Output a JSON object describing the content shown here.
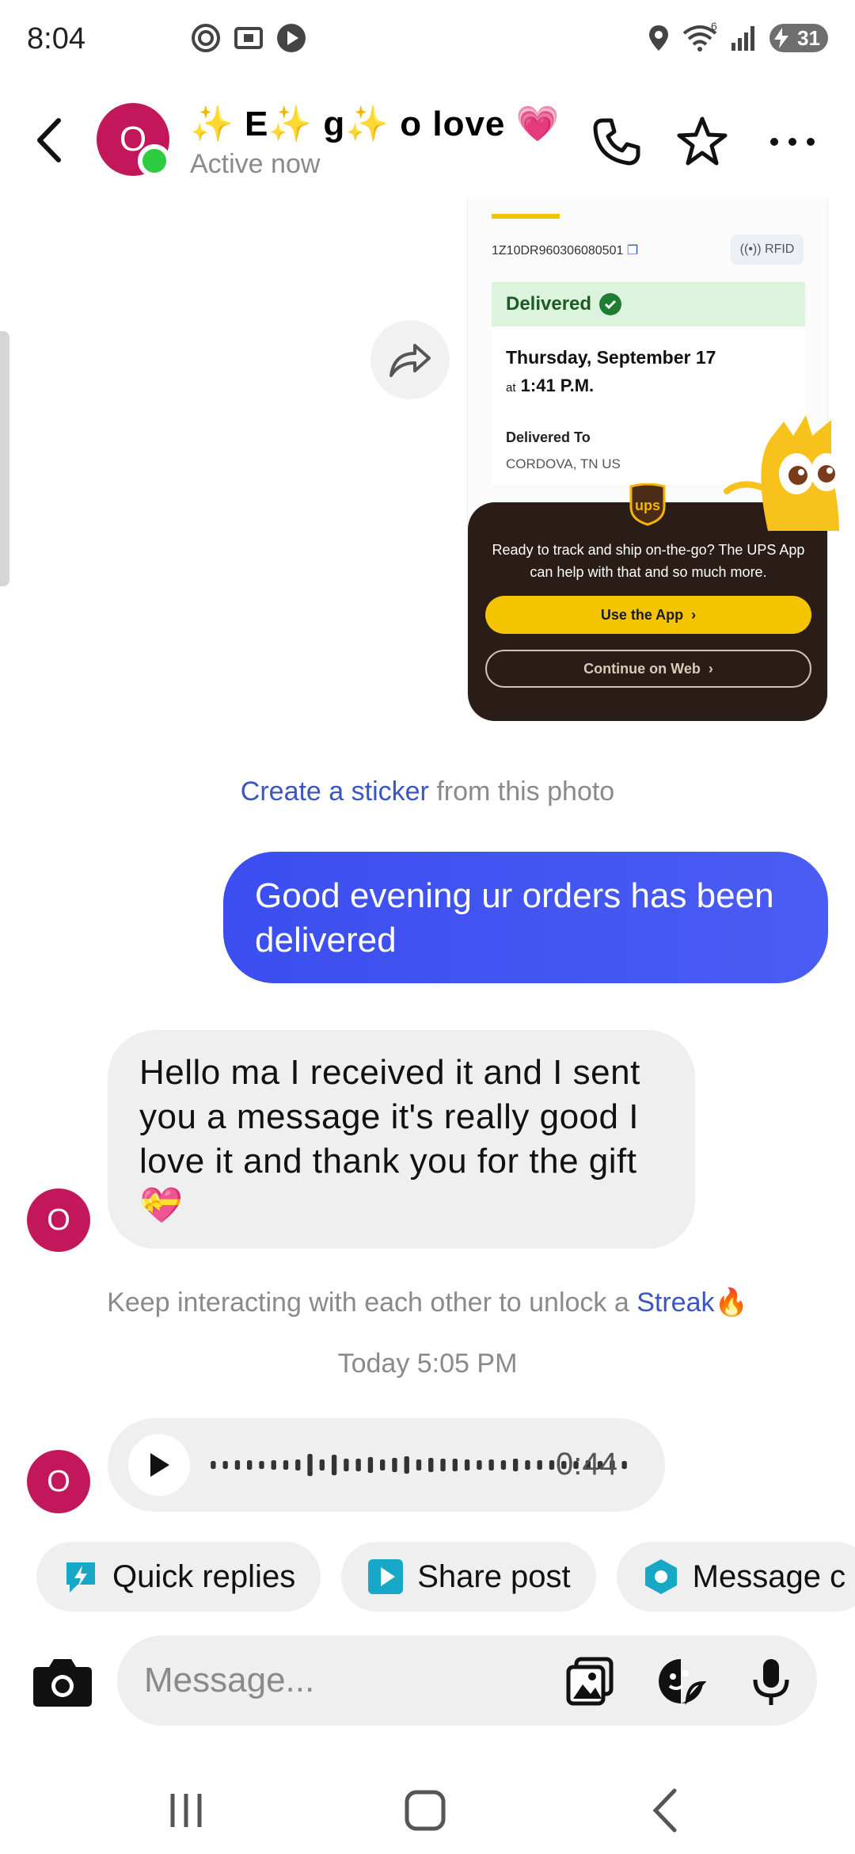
{
  "status_bar": {
    "time": "8:04",
    "battery": "31",
    "signal_label": "6",
    "left_icons": [
      "focus-icon",
      "screen-record-icon",
      "play-icon"
    ],
    "right_icons": [
      "location-icon",
      "wifi-icon",
      "signal-icon",
      "battery-icon"
    ]
  },
  "header": {
    "contact_name": "✨ E✨ g✨ o  love 💗",
    "avatar_initial": "O",
    "status": "Active now",
    "icons": [
      "back-icon",
      "phone-icon",
      "star-icon",
      "more-icon"
    ]
  },
  "shared_image": {
    "tracking_number": "1Z10DR960306080501",
    "rfid_label": "((•)) RFID",
    "delivered_label": "Delivered",
    "date": "Thursday, September 17",
    "time_prefix": "at",
    "time": "1:41 P.M.",
    "delivered_to_label": "Delivered To",
    "city": "CORDOVA, TN US",
    "promo_text": "Ready to track and ship on-the-go? The UPS App can help with that and so much more.",
    "use_app_label": "Use the App",
    "continue_web_label": "Continue on Web",
    "logo_text": "ups"
  },
  "sticker_prompt": {
    "link": "Create a sticker",
    "rest": " from this photo"
  },
  "messages": {
    "outgoing_1": "Good evening ur orders has been delivered",
    "incoming_1": "Hello ma I  received it and I sent you a message it's really good  I love it and thank you for the gift 💝",
    "incoming_avatar": "O"
  },
  "streak": {
    "text": "Keep interacting with each other to unlock a ",
    "link": "Streak",
    "emoji": "🔥"
  },
  "timestamp": "Today 5:05 PM",
  "voice_message": {
    "duration": "0:44"
  },
  "chips": [
    {
      "label": "Quick replies",
      "icon": "lightning-icon",
      "color": "#17a7c7"
    },
    {
      "label": "Share post",
      "icon": "play-square-icon",
      "color": "#17a7c7"
    },
    {
      "label": "Message c",
      "icon": "hexagon-icon",
      "color": "#17a7c7"
    }
  ],
  "composer": {
    "placeholder": "Message..."
  },
  "colors": {
    "accent": "#3b4ef0",
    "avatar": "#c2185b",
    "online": "#2ecc40",
    "link": "#3a55c4"
  }
}
